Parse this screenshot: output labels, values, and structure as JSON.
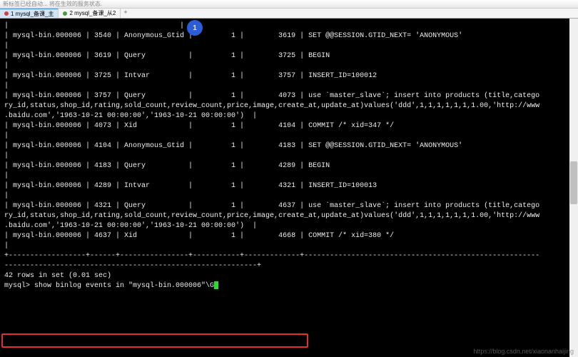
{
  "window_title": "新标签已经自动... 将在生效的服务状态.",
  "tabs": [
    {
      "label": "1 mysql_备课_主",
      "active": true,
      "dot": "red"
    },
    {
      "label": "2 mysql_备课_从2",
      "active": false,
      "dot": "green"
    }
  ],
  "highlight_badge": "1",
  "terminal_rows": [
    "|                                        |",
    "| mysql-bin.000006 | 3540 | Anonymous_Gtid |         1 |        3619 | SET @@SESSION.GTID_NEXT= 'ANONYMOUS'",
    "|",
    "| mysql-bin.000006 | 3619 | Query          |         1 |        3725 | BEGIN",
    "|",
    "| mysql-bin.000006 | 3725 | Intvar         |         1 |        3757 | INSERT_ID=100012",
    "|",
    "| mysql-bin.000006 | 3757 | Query          |         1 |        4073 | use `master_slave`; insert into products (title,catego",
    "ry_id,status,shop_id,rating,sold_count,review_count,price,image,create_at,update_at)values('ddd',1,1,1,1,1,1,1.00,'http://www",
    ".baidu.com','1963-10-21 00:00:00','1963-10-21 00:00:00')  |",
    "| mysql-bin.000006 | 4073 | Xid            |         1 |        4104 | COMMIT /* xid=347 */",
    "|",
    "| mysql-bin.000006 | 4104 | Anonymous_Gtid |         1 |        4183 | SET @@SESSION.GTID_NEXT= 'ANONYMOUS'",
    "|",
    "| mysql-bin.000006 | 4183 | Query          |         1 |        4289 | BEGIN",
    "|",
    "| mysql-bin.000006 | 4289 | Intvar         |         1 |        4321 | INSERT_ID=100013",
    "|",
    "| mysql-bin.000006 | 4321 | Query          |         1 |        4637 | use `master_slave`; insert into products (title,catego",
    "ry_id,status,shop_id,rating,sold_count,review_count,price,image,create_at,update_at)values('ddd',1,1,1,1,1,1,1.00,'http://www",
    ".baidu.com','1963-10-21 00:00:00','1963-10-21 00:00:00')  |",
    "| mysql-bin.000006 | 4637 | Xid            |         1 |        4668 | COMMIT /* xid=380 */",
    "|",
    "+------------------+------+----------------+-----------+-------------+-------------------------------------------------------",
    "-----------------------------------------------------------+",
    "42 rows in set (0.01 sec)",
    "",
    "mysql> show binlog events in \"mysql-bin.000006\"\\G"
  ],
  "prompt_cursor": true,
  "watermark": "https://blog.csdn.net/xiaonanhaijing"
}
